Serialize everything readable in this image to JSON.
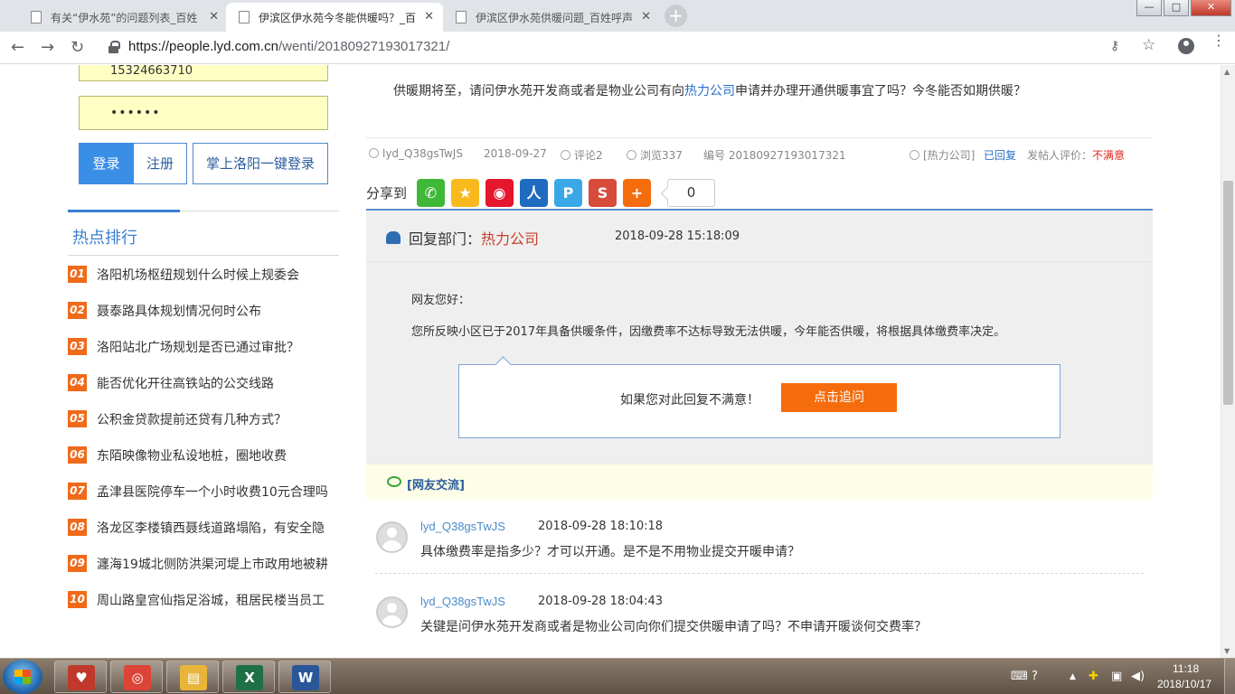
{
  "browser": {
    "tabs": [
      {
        "title": "有关“伊水苑”的问题列表_百姓",
        "active": false
      },
      {
        "title": "伊滨区伊水苑今冬能供暖吗？_百",
        "active": true
      },
      {
        "title": "伊滨区伊水苑供暖问题_百姓呼声",
        "active": false
      }
    ],
    "tab_close_glyph": "✕",
    "new_tab_glyph": "+",
    "window_controls": {
      "minimize": "—",
      "maximize": "□",
      "close": "✕"
    },
    "nav": {
      "back": "←",
      "forward": "→",
      "reload": "↻"
    },
    "url_host": "https://people.lyd.com.cn",
    "url_path": "/wenti/20180927193017321/",
    "icons": {
      "key": "⚷",
      "star": "☆",
      "menu": "⋮"
    }
  },
  "login": {
    "username_value": "15324663710",
    "password_value": "••••••",
    "login_label": "登录",
    "register_label": "注册",
    "onekey_label": "掌上洛阳一键登录"
  },
  "hot": {
    "title": "热点排行",
    "items": [
      {
        "num": "01",
        "text": "洛阳机场枢纽规划什么时候上规委会"
      },
      {
        "num": "02",
        "text": "聂泰路具体规划情况何时公布"
      },
      {
        "num": "03",
        "text": "洛阳站北广场规划是否已通过审批？"
      },
      {
        "num": "04",
        "text": "能否优化开往高铁站的公交线路"
      },
      {
        "num": "05",
        "text": "公积金贷款提前还贷有几种方式？"
      },
      {
        "num": "06",
        "text": "东陌映像物业私设地桩，圈地收费"
      },
      {
        "num": "07",
        "text": "孟津县医院停车一个小时收费10元合理吗"
      },
      {
        "num": "08",
        "text": "洛龙区李楼镇西聂线道路塌陷，有安全隐"
      },
      {
        "num": "09",
        "text": "瀍海19城北侧防洪渠河堤上市政用地被耕"
      },
      {
        "num": "10",
        "text": "周山路皇宫仙指足浴城，租居民楼当员工"
      }
    ]
  },
  "question": {
    "text_before": "供暖期将至，请问伊水苑开发商或者是物业公司有向",
    "keyword": "热力公司",
    "text_after": "申请并办理开通供暖事宜了吗？今冬能否如期供暖？"
  },
  "meta": {
    "user": "lyd_Q38gsTwJS",
    "date": "2018-09-27",
    "comments": "评论2",
    "views": "浏览337",
    "number": "编号 20180927193017321",
    "dept": "[热力公司]",
    "status": "已回复",
    "rating_label": "发帖人评价：",
    "rating_value": "不满意"
  },
  "share": {
    "label": "分享到",
    "count": "0",
    "icons": [
      {
        "name": "wechat-share-icon",
        "color": "#3fb837",
        "glyph": "✆"
      },
      {
        "name": "qzone-share-icon",
        "color": "#f7b91e",
        "glyph": "★"
      },
      {
        "name": "weibo-share-icon",
        "color": "#e6162d",
        "glyph": "◉"
      },
      {
        "name": "renren-share-icon",
        "color": "#1f6bbf",
        "glyph": "人"
      },
      {
        "name": "tencent-weibo-share-icon",
        "color": "#3aa8e6",
        "glyph": "P"
      },
      {
        "name": "sina-share-icon",
        "color": "#d84a3a",
        "glyph": "S"
      },
      {
        "name": "more-share-icon",
        "color": "#f56c0c",
        "glyph": "+"
      }
    ]
  },
  "reply": {
    "dept_label": "回复部门：",
    "dept_name": "热力公司",
    "time": "2018-09-28 15:18:09",
    "greeting": "网友您好：",
    "body": "您所反映小区已于2017年具备供暖条件，因缴费率不达标导致无法供暖，今年能否供暖，将根据具体缴费率决定。",
    "followup_prompt": "如果您对此回复不满意！",
    "followup_button": "点击追问"
  },
  "exchange": {
    "title": "[网友交流]",
    "comments": [
      {
        "user": "lyd_Q38gsTwJS",
        "time": "2018-09-28 18:10:18",
        "text": "具体缴费率是指多少？才可以开通。是不是不用物业提交开暖申请？"
      },
      {
        "user": "lyd_Q38gsTwJS",
        "time": "2018-09-28 18:04:43",
        "text": "关键是问伊水苑开发商或者是物业公司向你们提交供暖申请了吗？不申请开暖谈何交费率？"
      }
    ]
  },
  "taskbar": {
    "clock_time": "11:18",
    "clock_date": "2018/10/17",
    "apps": [
      {
        "name": "solitaire-app-icon",
        "glyph": "♥",
        "color": "#c0392b"
      },
      {
        "name": "chrome-app-icon",
        "glyph": "◎",
        "color": "#db4437"
      },
      {
        "name": "explorer-app-icon",
        "glyph": "▤",
        "color": "#e8b53a"
      },
      {
        "name": "excel-app-icon",
        "glyph": "X",
        "color": "#1e7145"
      },
      {
        "name": "word-app-icon",
        "glyph": "W",
        "color": "#2b579a"
      }
    ],
    "tray_icons": [
      "⌨",
      "?",
      "▲",
      "✚",
      "▣",
      "◀)"
    ]
  }
}
